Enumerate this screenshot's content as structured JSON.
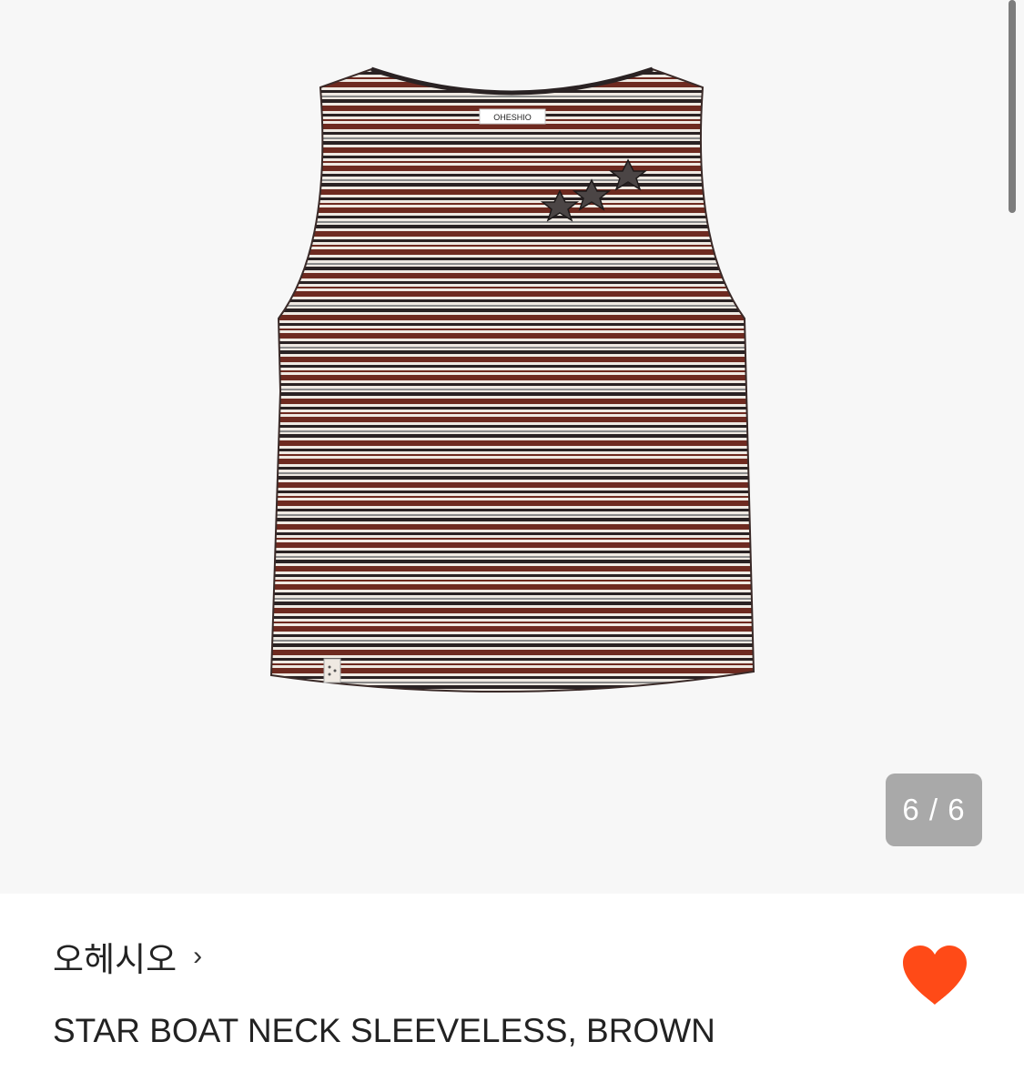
{
  "gallery": {
    "counter": "6 / 6",
    "image_subject": "striped-sleeveless-top",
    "neck_label": "OHESHIO"
  },
  "product": {
    "brand": "오헤시오",
    "brand_chevron": "›",
    "title": "STAR BOAT NECK SLEEVELESS, BROWN",
    "liked": true
  },
  "colors": {
    "heart": "#ff4a17",
    "stripe_brown": "#6e2a20",
    "stripe_dark": "#2a2223",
    "stripe_cream": "#efe9e2",
    "counter_bg": "#a9a9a9"
  },
  "icons": {
    "like": "heart-icon",
    "brand_link": "chevron-right-icon"
  }
}
